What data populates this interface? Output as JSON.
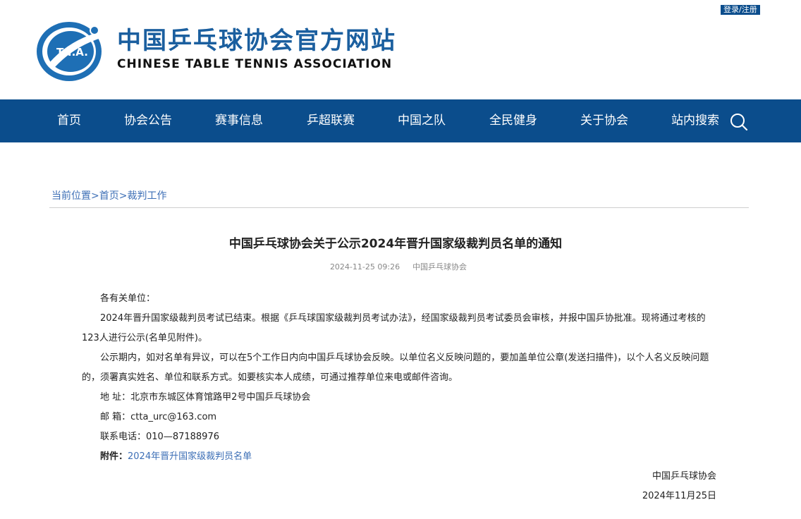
{
  "header": {
    "login_label": "登录/注册",
    "site_title_cn": "中国乒乓球协会官方网站",
    "site_title_en": "CHINESE TABLE TENNIS ASSOCIATION",
    "logo_text": "T.T.A.",
    "brand_color": "#0b4d8c"
  },
  "nav": {
    "items": [
      "首页",
      "协会公告",
      "赛事信息",
      "乒超联赛",
      "中国之队",
      "全民健身",
      "关于协会",
      "站内搜索"
    ],
    "search_icon": "search-icon"
  },
  "breadcrumb": {
    "label": "当前位置",
    "home": "首页",
    "current": "裁判工作",
    "separator": ">"
  },
  "article": {
    "title": "中国乒乓球协会关于公示2024年晋升国家级裁判员名单的通知",
    "date": "2024-11-25 09:26",
    "source": "中国乒乓球协会",
    "salutation": "各有关单位：",
    "para1": "2024年晋升国家级裁判员考试已结束。根据《乒乓球国家级裁判员考试办法》，经国家级裁判员考试委员会审核，并报中国乒协批准。现将通过考核的123人进行公示(名单见附件)。",
    "para2": "公示期内，如对名单有异议，可以在5个工作日内向中国乒乓球协会反映。以单位名义反映问题的，要加盖单位公章(发送扫描件)，以个人名义反映问题的，须署真实姓名、单位和联系方式。如要核实本人成绩，可通过推荐单位来电或邮件咨询。",
    "address": "地 址：北京市东城区体育馆路甲2号中国乒乓球协会",
    "email": "邮 箱：ctta_urc@163.com",
    "phone": "联系电话：010—87188976",
    "attachment_label": "附件：",
    "attachment_link": "2024年晋升国家级裁判员名单",
    "signature": "中国乒乓球协会",
    "sign_date": "2024年11月25日"
  }
}
